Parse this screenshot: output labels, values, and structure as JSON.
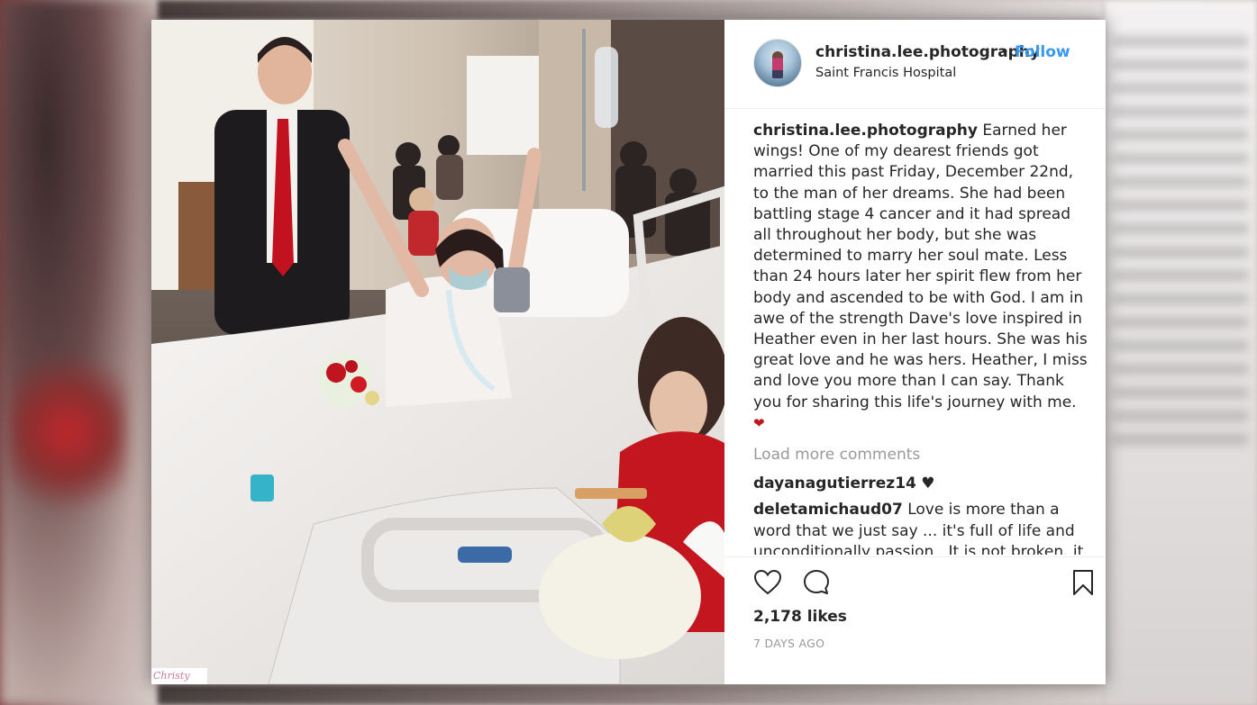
{
  "post": {
    "username": "christina.lee.photography",
    "separator": "•",
    "follow_label": "Follow",
    "location": "Saint Francis Hospital",
    "caption_user": "christina.lee.photography",
    "caption_text": "Earned her wings! One of my dearest friends got married this past Friday, December 22nd, to the man of her dreams. She had been battling stage 4 cancer and it had spread all throughout her body, but she was determined to marry her soul mate. Less than 24 hours later her spirit flew from her body and ascended to be with God. I am in awe of the strength Dave's love inspired in Heather even in her last hours. She was his great love and he was hers. Heather, I miss and love you more than I can say. Thank you for sharing this life's journey with me.",
    "caption_emoji": "❤",
    "load_more": "Load more comments",
    "comments": [
      {
        "user": "dayanagutierrez14",
        "text": "♥"
      },
      {
        "user": "deletamichaud07",
        "text": "Love is more than a word that we just say ... it's full of life and unconditionally passion . It is not broken, it is not lifeless, it is not hugely nor brutal. IT"
      }
    ],
    "likes": "2,178 likes",
    "time": "7 DAYS AGO",
    "photo_watermark": "Christy"
  },
  "icons": {
    "like": "heart-outline-icon",
    "comment": "comment-bubble-icon",
    "save": "bookmark-icon"
  },
  "colors": {
    "follow": "#3897f0",
    "text": "#262626",
    "muted": "#999999",
    "heart": "#c0161e"
  }
}
